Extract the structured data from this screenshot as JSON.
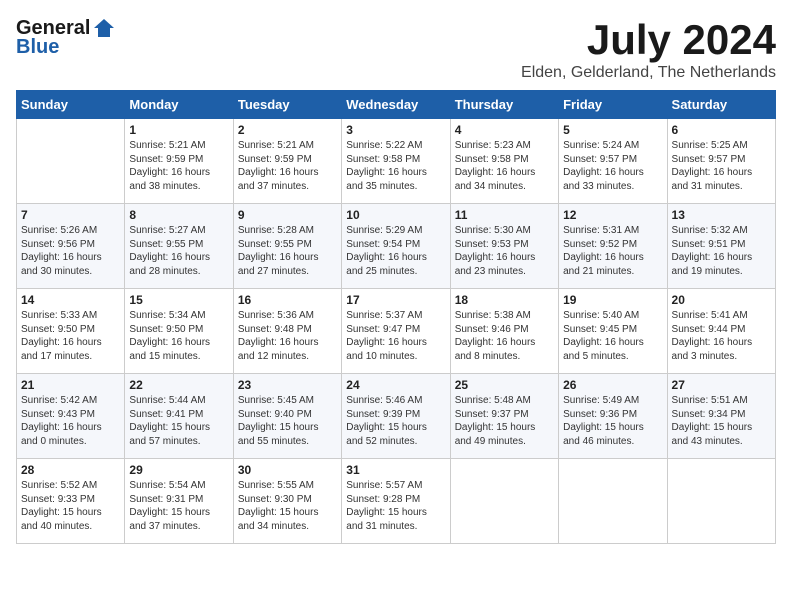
{
  "logo": {
    "general": "General",
    "blue": "Blue"
  },
  "header": {
    "month": "July 2024",
    "location": "Elden, Gelderland, The Netherlands"
  },
  "weekdays": [
    "Sunday",
    "Monday",
    "Tuesday",
    "Wednesday",
    "Thursday",
    "Friday",
    "Saturday"
  ],
  "weeks": [
    [
      {
        "day": "",
        "info": ""
      },
      {
        "day": "1",
        "info": "Sunrise: 5:21 AM\nSunset: 9:59 PM\nDaylight: 16 hours\nand 38 minutes."
      },
      {
        "day": "2",
        "info": "Sunrise: 5:21 AM\nSunset: 9:59 PM\nDaylight: 16 hours\nand 37 minutes."
      },
      {
        "day": "3",
        "info": "Sunrise: 5:22 AM\nSunset: 9:58 PM\nDaylight: 16 hours\nand 35 minutes."
      },
      {
        "day": "4",
        "info": "Sunrise: 5:23 AM\nSunset: 9:58 PM\nDaylight: 16 hours\nand 34 minutes."
      },
      {
        "day": "5",
        "info": "Sunrise: 5:24 AM\nSunset: 9:57 PM\nDaylight: 16 hours\nand 33 minutes."
      },
      {
        "day": "6",
        "info": "Sunrise: 5:25 AM\nSunset: 9:57 PM\nDaylight: 16 hours\nand 31 minutes."
      }
    ],
    [
      {
        "day": "7",
        "info": "Sunrise: 5:26 AM\nSunset: 9:56 PM\nDaylight: 16 hours\nand 30 minutes."
      },
      {
        "day": "8",
        "info": "Sunrise: 5:27 AM\nSunset: 9:55 PM\nDaylight: 16 hours\nand 28 minutes."
      },
      {
        "day": "9",
        "info": "Sunrise: 5:28 AM\nSunset: 9:55 PM\nDaylight: 16 hours\nand 27 minutes."
      },
      {
        "day": "10",
        "info": "Sunrise: 5:29 AM\nSunset: 9:54 PM\nDaylight: 16 hours\nand 25 minutes."
      },
      {
        "day": "11",
        "info": "Sunrise: 5:30 AM\nSunset: 9:53 PM\nDaylight: 16 hours\nand 23 minutes."
      },
      {
        "day": "12",
        "info": "Sunrise: 5:31 AM\nSunset: 9:52 PM\nDaylight: 16 hours\nand 21 minutes."
      },
      {
        "day": "13",
        "info": "Sunrise: 5:32 AM\nSunset: 9:51 PM\nDaylight: 16 hours\nand 19 minutes."
      }
    ],
    [
      {
        "day": "14",
        "info": "Sunrise: 5:33 AM\nSunset: 9:50 PM\nDaylight: 16 hours\nand 17 minutes."
      },
      {
        "day": "15",
        "info": "Sunrise: 5:34 AM\nSunset: 9:50 PM\nDaylight: 16 hours\nand 15 minutes."
      },
      {
        "day": "16",
        "info": "Sunrise: 5:36 AM\nSunset: 9:48 PM\nDaylight: 16 hours\nand 12 minutes."
      },
      {
        "day": "17",
        "info": "Sunrise: 5:37 AM\nSunset: 9:47 PM\nDaylight: 16 hours\nand 10 minutes."
      },
      {
        "day": "18",
        "info": "Sunrise: 5:38 AM\nSunset: 9:46 PM\nDaylight: 16 hours\nand 8 minutes."
      },
      {
        "day": "19",
        "info": "Sunrise: 5:40 AM\nSunset: 9:45 PM\nDaylight: 16 hours\nand 5 minutes."
      },
      {
        "day": "20",
        "info": "Sunrise: 5:41 AM\nSunset: 9:44 PM\nDaylight: 16 hours\nand 3 minutes."
      }
    ],
    [
      {
        "day": "21",
        "info": "Sunrise: 5:42 AM\nSunset: 9:43 PM\nDaylight: 16 hours\nand 0 minutes."
      },
      {
        "day": "22",
        "info": "Sunrise: 5:44 AM\nSunset: 9:41 PM\nDaylight: 15 hours\nand 57 minutes."
      },
      {
        "day": "23",
        "info": "Sunrise: 5:45 AM\nSunset: 9:40 PM\nDaylight: 15 hours\nand 55 minutes."
      },
      {
        "day": "24",
        "info": "Sunrise: 5:46 AM\nSunset: 9:39 PM\nDaylight: 15 hours\nand 52 minutes."
      },
      {
        "day": "25",
        "info": "Sunrise: 5:48 AM\nSunset: 9:37 PM\nDaylight: 15 hours\nand 49 minutes."
      },
      {
        "day": "26",
        "info": "Sunrise: 5:49 AM\nSunset: 9:36 PM\nDaylight: 15 hours\nand 46 minutes."
      },
      {
        "day": "27",
        "info": "Sunrise: 5:51 AM\nSunset: 9:34 PM\nDaylight: 15 hours\nand 43 minutes."
      }
    ],
    [
      {
        "day": "28",
        "info": "Sunrise: 5:52 AM\nSunset: 9:33 PM\nDaylight: 15 hours\nand 40 minutes."
      },
      {
        "day": "29",
        "info": "Sunrise: 5:54 AM\nSunset: 9:31 PM\nDaylight: 15 hours\nand 37 minutes."
      },
      {
        "day": "30",
        "info": "Sunrise: 5:55 AM\nSunset: 9:30 PM\nDaylight: 15 hours\nand 34 minutes."
      },
      {
        "day": "31",
        "info": "Sunrise: 5:57 AM\nSunset: 9:28 PM\nDaylight: 15 hours\nand 31 minutes."
      },
      {
        "day": "",
        "info": ""
      },
      {
        "day": "",
        "info": ""
      },
      {
        "day": "",
        "info": ""
      }
    ]
  ]
}
